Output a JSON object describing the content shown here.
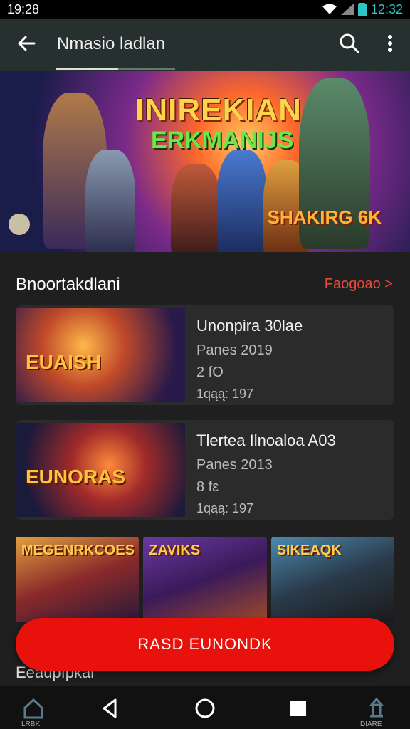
{
  "status": {
    "left_time": "19:28",
    "right_time": "12:32"
  },
  "appbar": {
    "title": "Nmasio ladlan"
  },
  "hero": {
    "title_line1": "INIREKIAN",
    "title_line2": "ERKMANIJS",
    "corner_text": "SHAKIRG 6K"
  },
  "section": {
    "title": "Bnoortakdlani",
    "link": "Faogoao >"
  },
  "cards": [
    {
      "thumb_label": "EUAISH",
      "title": "Unonpira 30lae",
      "meta1": "Panes 2019",
      "meta2": "2 fΟ",
      "meta3": "1qąą: 197"
    },
    {
      "thumb_label": "EUNORAS",
      "title": "Tlertea Ilnoaloa A03",
      "meta1": "Panes 2013",
      "meta2": "8 fε",
      "meta3": "1qąą: 197"
    }
  ],
  "tiles": [
    {
      "label": "MEGENRKCOES"
    },
    {
      "label": "ZAVIKS"
    },
    {
      "label": "SIKEAQK"
    }
  ],
  "cta": {
    "label": "RASD EUNONDK"
  },
  "bottom": {
    "text": "Eeaupıpkai"
  },
  "nav": {
    "left_label": "LRBK",
    "right_label": "DIARE"
  }
}
